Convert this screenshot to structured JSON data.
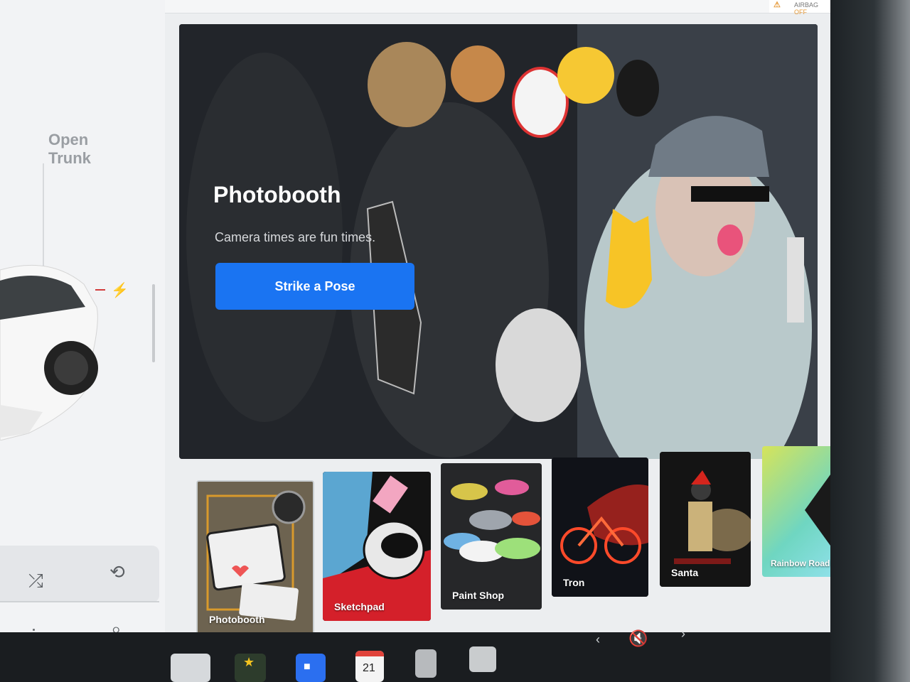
{
  "car_panel": {
    "trunk_label": "Open\nTrunk"
  },
  "status": {
    "airbag_label": "AIRBAG",
    "airbag_state": "OFF"
  },
  "hero": {
    "title": "Photobooth",
    "subtitle": "Camera times are fun times.",
    "cta_label": "Strike a Pose"
  },
  "apps": [
    {
      "label": "Photobooth"
    },
    {
      "label": "Sketchpad"
    },
    {
      "label": "Paint Shop"
    },
    {
      "label": "Tron"
    },
    {
      "label": "Santa"
    },
    {
      "label": "Rainbow Road"
    }
  ],
  "dock": {
    "calendar_day": "21"
  },
  "colors": {
    "accent": "#1a74f2",
    "screen_bg": "#eceef0",
    "hero_bg": "#1d1f23"
  }
}
